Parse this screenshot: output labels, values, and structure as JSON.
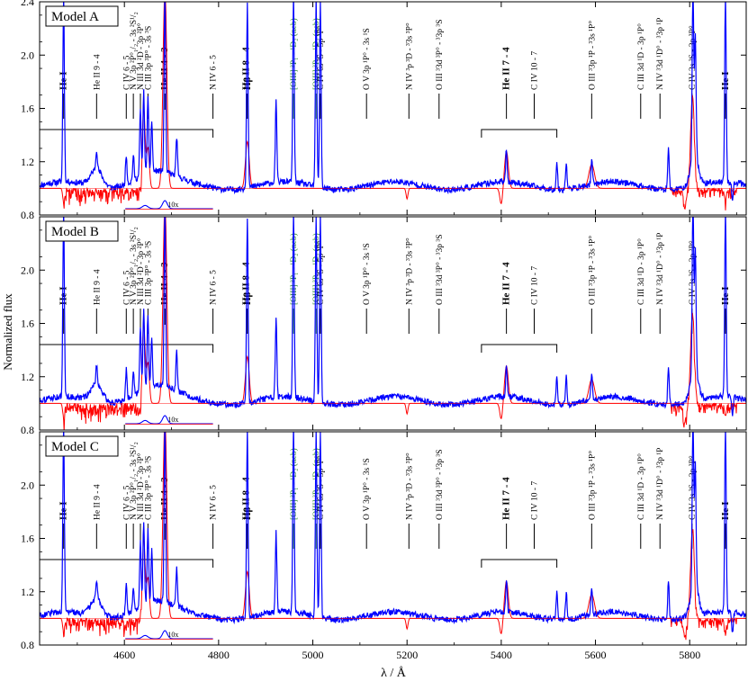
{
  "figure": {
    "ylabel": "Normalized flux",
    "xlabel": "λ / Å",
    "colors": {
      "model": "#ff0000",
      "observed": "#0000ff",
      "frame": "#000000",
      "green_line": "#2e8b2e"
    }
  },
  "chart_data": [
    {
      "type": "line",
      "panel": "Model A",
      "xlim": [
        4420,
        5920
      ],
      "ylim": [
        0.8,
        2.4
      ],
      "x_ticks": [
        4600,
        4800,
        5000,
        5200,
        5400,
        5600,
        5800
      ],
      "x_tick_labels": [],
      "y_ticks": [
        0.8,
        1.2,
        1.6,
        2.0,
        2.4
      ],
      "y_tick_labels": [
        "0.8",
        "1.2",
        "1.6",
        "2.0",
        "2.4"
      ],
      "inset_label": "10x",
      "series": [
        {
          "color": "blue"
        },
        {
          "color": "red"
        }
      ]
    },
    {
      "type": "line",
      "panel": "Model B",
      "xlim": [
        4420,
        5920
      ],
      "ylim": [
        0.8,
        2.4
      ],
      "x_ticks": [
        4600,
        4800,
        5000,
        5200,
        5400,
        5600,
        5800
      ],
      "x_tick_labels": [],
      "y_ticks": [
        0.8,
        1.2,
        1.6,
        2.0,
        2.4
      ],
      "y_tick_labels": [
        "0.8",
        "1.2",
        "1.6",
        "2.0",
        ""
      ],
      "inset_label": "10x",
      "series": [
        {
          "color": "blue"
        },
        {
          "color": "red"
        }
      ]
    },
    {
      "type": "line",
      "panel": "Model C",
      "xlim": [
        4420,
        5920
      ],
      "ylim": [
        0.8,
        2.4
      ],
      "x_ticks": [
        4600,
        4800,
        5000,
        5200,
        5400,
        5600,
        5800
      ],
      "x_tick_labels": [
        "4600",
        "4800",
        "5000",
        "5200",
        "5400",
        "5600",
        "5800"
      ],
      "y_ticks": [
        0.8,
        1.2,
        1.6,
        2.0,
        2.4
      ],
      "y_tick_labels": [
        "0.8",
        "1.2",
        "1.6",
        "2.0",
        ""
      ],
      "inset_label": "10x",
      "series": [
        {
          "color": "blue"
        },
        {
          "color": "red"
        }
      ]
    }
  ],
  "line_ids": [
    {
      "wl": 4471,
      "label": "He I",
      "bold": true,
      "style": "normal"
    },
    {
      "wl": 4541,
      "label": "He II 9 - 4",
      "bold": false,
      "style": "normal"
    },
    {
      "wl": 4604,
      "label": "C IV 6 - 5",
      "bold": false,
      "style": "normal"
    },
    {
      "wl": 4619,
      "label": "N V 3p ²P°₁/₂ - 3s ²S¹/₂",
      "bold": false,
      "style": "normal"
    },
    {
      "wl": 4634,
      "label": "N III 3d ²D - 3p ²P°",
      "bold": false,
      "style": "normal"
    },
    {
      "wl": 4650,
      "label": "C III 3p ³P° - 3s ³S",
      "bold": false,
      "style": "normal"
    },
    {
      "wl": 4686,
      "label": "He II 4 - 3",
      "bold": true,
      "style": "leader"
    },
    {
      "wl": 4788,
      "label": "N IV 6 - 5",
      "bold": false,
      "style": "normal"
    },
    {
      "wl": 4859,
      "label": "He II 8 - 4",
      "bold": true,
      "style": "normal"
    },
    {
      "wl": 4861,
      "label": "Hβ",
      "bold": true,
      "style": "normal"
    },
    {
      "wl": 4959,
      "label": "[OIII] ³P₁ - ¹D₂ (neb)",
      "bold": false,
      "style": "green"
    },
    {
      "wl": 5007,
      "label": "[OIII] ³P₂ - ¹D₂ (neb)",
      "bold": false,
      "style": "green"
    },
    {
      "wl": 5016,
      "label": "C IV 6s ²S - 5p ²P°",
      "bold": false,
      "style": "normal"
    },
    {
      "wl": 5114,
      "label": "O V 3p ¹P° - 3s ¹S",
      "bold": false,
      "style": "normal"
    },
    {
      "wl": 5204,
      "label": "N IV ³p ³D - ³3s ³P°",
      "bold": false,
      "style": "normal"
    },
    {
      "wl": 5268,
      "label": "O III ³3d ³P° - ³3p ³S",
      "bold": false,
      "style": "normal"
    },
    {
      "wl": 5411,
      "label": "He II 7 - 4",
      "bold": true,
      "style": "normal"
    },
    {
      "wl": 5470,
      "label": "C IV 10 - 7",
      "bold": false,
      "style": "normal"
    },
    {
      "wl": 5592,
      "label": "O III ³3p ¹P - ³3s ¹P°",
      "bold": false,
      "style": "normal"
    },
    {
      "wl": 5696,
      "label": "C III 3d ¹D - 3p ¹P°",
      "bold": false,
      "style": "normal"
    },
    {
      "wl": 5737,
      "label": "N IV ³3d ¹D° - ³3p ¹P",
      "bold": false,
      "style": "normal"
    },
    {
      "wl": 5805,
      "label": "C IV 3s ²S - 3p ²P°",
      "bold": false,
      "style": "normal"
    },
    {
      "wl": 5876,
      "label": "He I",
      "bold": true,
      "style": "normal"
    }
  ],
  "brackets": [
    {
      "from": 4420,
      "to": 4788
    },
    {
      "from": 5358,
      "to": 5518
    }
  ],
  "emission_lines": [
    {
      "wl": 4471,
      "peak": 2.4
    },
    {
      "wl": 4541,
      "peak": 1.15
    },
    {
      "wl": 4604,
      "peak": 1.22
    },
    {
      "wl": 4619,
      "peak": 1.18
    },
    {
      "wl": 4634,
      "peak": 1.5
    },
    {
      "wl": 4641,
      "peak": 1.62
    },
    {
      "wl": 4650,
      "peak": 1.55
    },
    {
      "wl": 4658,
      "peak": 1.38
    },
    {
      "wl": 4686,
      "peak": 2.4
    },
    {
      "wl": 4711,
      "peak": 1.3
    },
    {
      "wl": 4861,
      "peak": 2.4
    },
    {
      "wl": 4922,
      "peak": 1.6
    },
    {
      "wl": 4959,
      "peak": 2.4
    },
    {
      "wl": 5007,
      "peak": 2.4
    },
    {
      "wl": 5016,
      "peak": 2.4
    },
    {
      "wl": 5411,
      "peak": 1.25
    },
    {
      "wl": 5518,
      "peak": 1.2
    },
    {
      "wl": 5538,
      "peak": 1.2
    },
    {
      "wl": 5592,
      "peak": 1.18
    },
    {
      "wl": 5755,
      "peak": 1.3
    },
    {
      "wl": 5807,
      "peak": 2.25
    },
    {
      "wl": 5812,
      "peak": 1.9
    },
    {
      "wl": 5876,
      "peak": 2.4
    },
    {
      "wl": 5891,
      "peak": 0.85
    }
  ]
}
